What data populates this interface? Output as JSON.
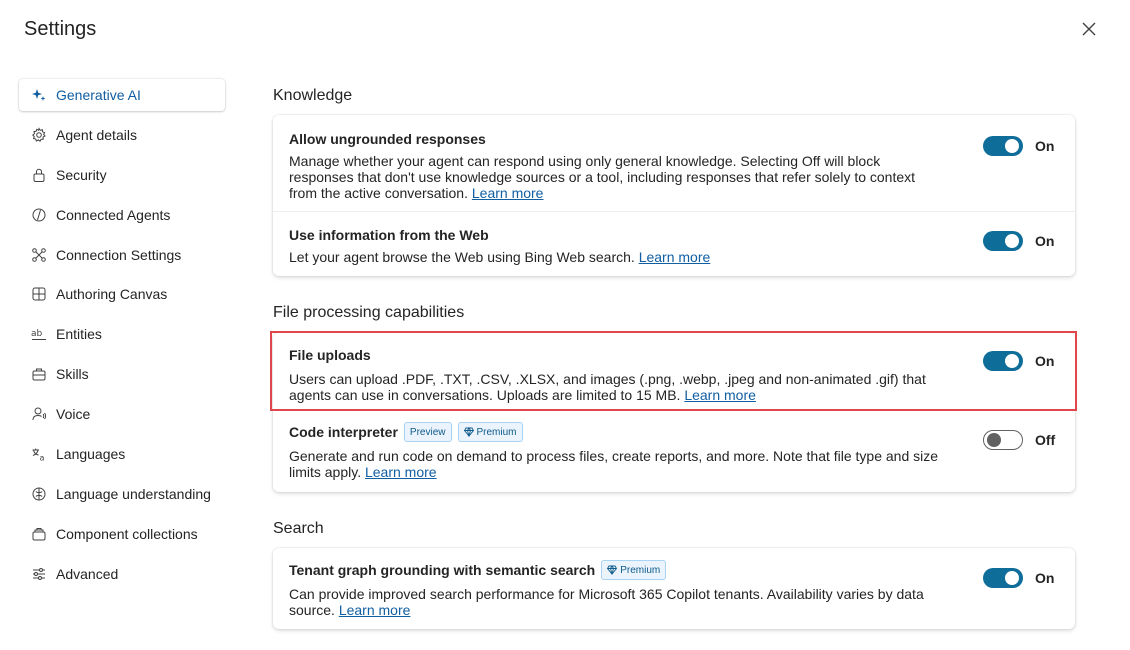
{
  "header": {
    "title": "Settings"
  },
  "sidebar": {
    "items": [
      {
        "label": "Generative AI",
        "icon": "sparkle-icon",
        "active": true
      },
      {
        "label": "Agent details",
        "icon": "gear-icon"
      },
      {
        "label": "Security",
        "icon": "lock-icon"
      },
      {
        "label": "Connected Agents",
        "icon": "connected-agents-icon"
      },
      {
        "label": "Connection Settings",
        "icon": "connection-icon"
      },
      {
        "label": "Authoring Canvas",
        "icon": "canvas-icon"
      },
      {
        "label": "Entities",
        "icon": "entities-icon"
      },
      {
        "label": "Skills",
        "icon": "skills-icon"
      },
      {
        "label": "Voice",
        "icon": "voice-icon"
      },
      {
        "label": "Languages",
        "icon": "languages-icon"
      },
      {
        "label": "Language understanding",
        "icon": "language-understanding-icon"
      },
      {
        "label": "Component collections",
        "icon": "component-collections-icon"
      },
      {
        "label": "Advanced",
        "icon": "sliders-icon"
      }
    ]
  },
  "sections": {
    "knowledge": {
      "title": "Knowledge",
      "ungrounded": {
        "title": "Allow ungrounded responses",
        "desc": "Manage whether your agent can respond using only general knowledge. Selecting Off will block responses that don't use knowledge sources or a tool, including responses that refer solely to context from the active conversation.",
        "link": "Learn more",
        "state": "On"
      },
      "web": {
        "title": "Use information from the Web",
        "desc": "Let your agent browse the Web using Bing Web search.",
        "link": "Learn more",
        "state": "On"
      }
    },
    "files": {
      "title": "File processing capabilities",
      "uploads": {
        "title": "File uploads",
        "desc": "Users can upload .PDF, .TXT, .CSV, .XLSX, and images (.png, .webp, .jpeg and non-animated .gif) that agents can use in conversations. Uploads are limited to 15 MB.",
        "link": "Learn more",
        "state": "On"
      },
      "code": {
        "title": "Code interpreter",
        "badge_preview": "Preview",
        "badge_premium": "Premium",
        "desc": "Generate and run code on demand to process files, create reports, and more. Note that file type and size limits apply.",
        "link": "Learn more",
        "state": "Off"
      }
    },
    "search": {
      "title": "Search",
      "tenant": {
        "title": "Tenant graph grounding with semantic search",
        "badge_premium": "Premium",
        "desc": "Can provide improved search performance for Microsoft 365 Copilot tenants. Availability varies by data source.",
        "link": "Learn more",
        "state": "On"
      }
    }
  },
  "colors": {
    "accent": "#0e6e99",
    "highlight": "#e0474c",
    "link": "#115ea3"
  }
}
